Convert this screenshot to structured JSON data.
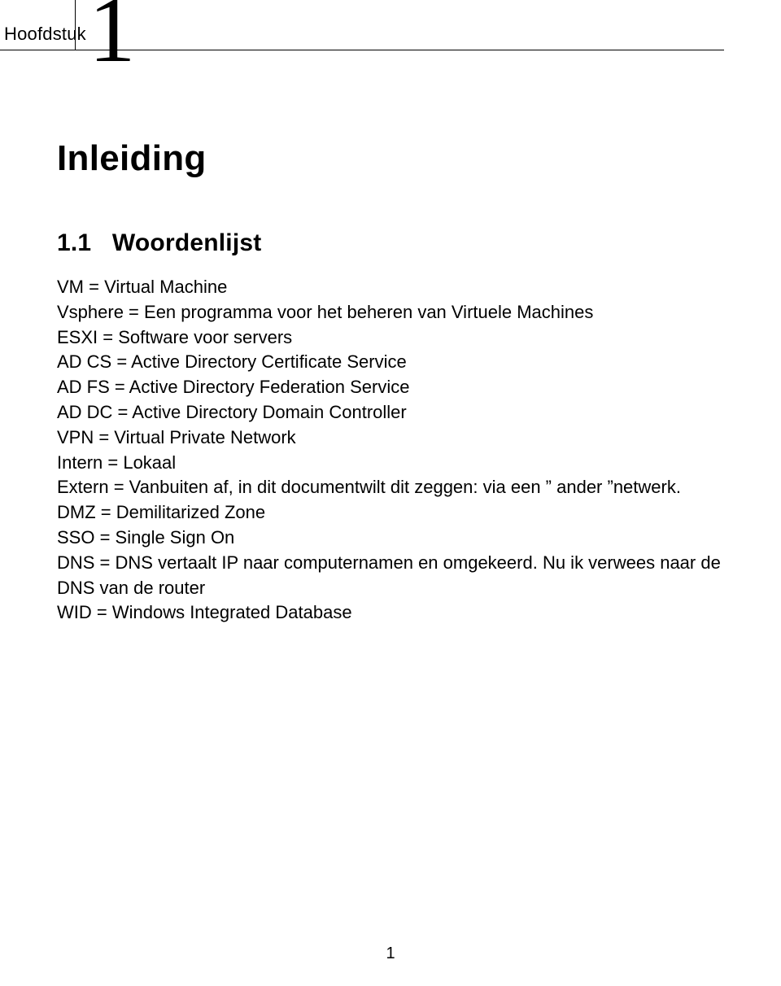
{
  "chapter": {
    "label": "Hoofdstuk",
    "number": "1",
    "title": "Inleiding"
  },
  "section": {
    "number": "1.1",
    "title": "Woordenlijst"
  },
  "lines": {
    "l1": "VM = Virtual Machine",
    "l2": "Vsphere = Een programma voor het beheren van Virtuele Machines",
    "l3": "ESXI = Software voor servers",
    "l4": "AD CS = Active Directory Certificate Service",
    "l5": "AD FS = Active Directory Federation Service",
    "l6": "AD DC = Active Directory Domain Controller",
    "l7": "VPN = Virtual Private Network",
    "l8": "Intern = Lokaal",
    "l9": "Extern = Vanbuiten af, in dit documentwilt dit zeggen: via een ” ander ”netwerk.",
    "l10": "DMZ = Demilitarized Zone",
    "l11": "SSO = Single Sign On",
    "l12": "DNS = DNS vertaalt IP naar computernamen en omgekeerd. Nu ik verwees naar de DNS van de router",
    "l13": "WID = Windows Integrated Database"
  },
  "pageNumber": "1"
}
